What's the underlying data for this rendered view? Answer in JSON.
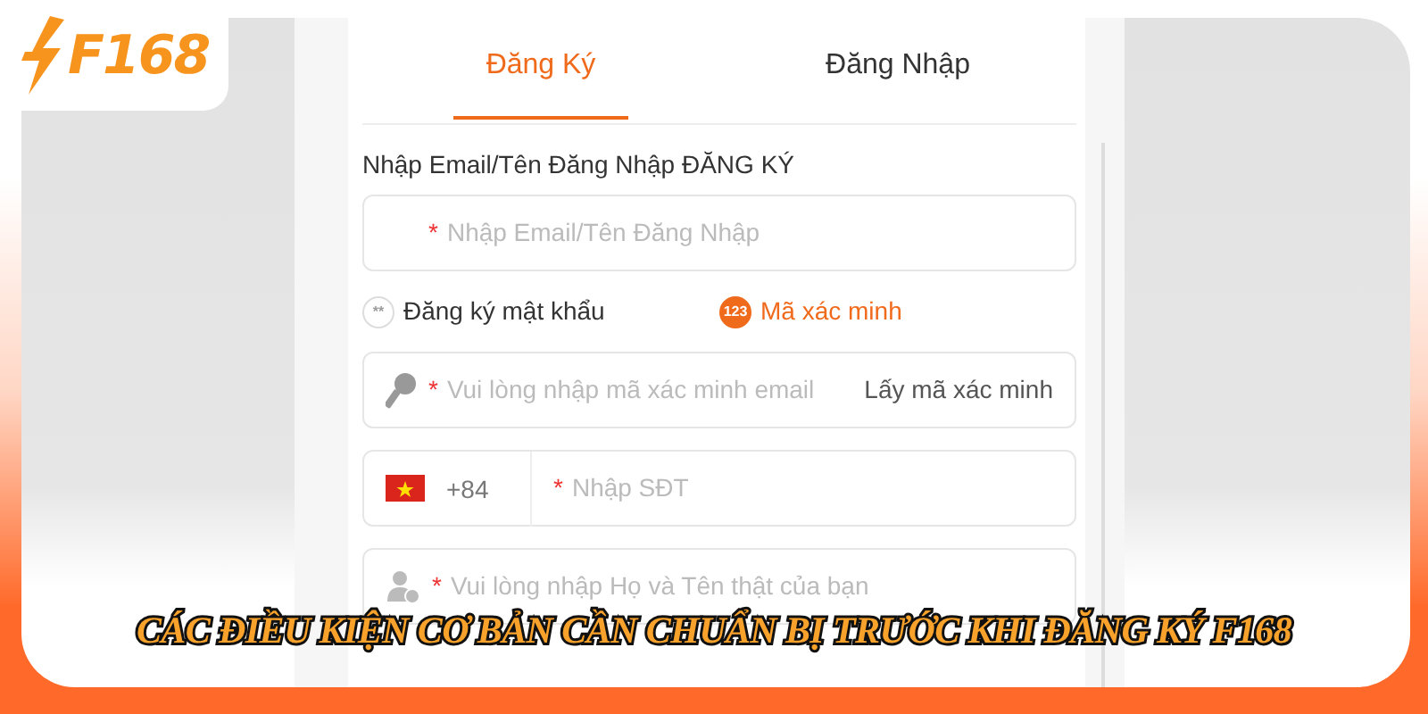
{
  "logo": {
    "text": "F168"
  },
  "tabs": [
    {
      "label": "Đăng Ký",
      "selected": true
    },
    {
      "label": "Đăng Nhập",
      "selected": false
    }
  ],
  "field_label": "Nhập Email/Tên Đăng Nhập ĐĂNG KÝ",
  "email_field": {
    "required_mark": "*",
    "placeholder": "Nhập Email/Tên Đăng Nhập"
  },
  "methods": [
    {
      "icon_text": "**",
      "label": "Đăng ký mật khẩu",
      "selected": false
    },
    {
      "icon_text": "123",
      "label": "Mã xác minh",
      "selected": true
    }
  ],
  "code_field": {
    "required_mark": "*",
    "placeholder": "Vui lòng nhập mã xác minh email",
    "action": "Lấy mã xác minh"
  },
  "phone_field": {
    "country_code": "+84",
    "required_mark": "*",
    "placeholder": "Nhập SĐT"
  },
  "name_field": {
    "required_mark": "*",
    "placeholder": "Vui lòng nhập Họ và Tên thật của bạn"
  },
  "caption": "CÁC ĐIỀU KIỆN CƠ BẢN CẦN CHUẨN BỊ TRƯỚC KHI ĐĂNG KÝ F168"
}
